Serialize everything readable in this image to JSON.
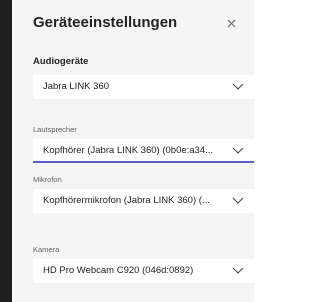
{
  "dialog": {
    "title": "Geräteeinstellungen",
    "close_icon": "close-icon"
  },
  "audio": {
    "section_label": "Audiogeräte",
    "device_value": "Jabra LINK 360",
    "speaker_label": "Lautsprecher",
    "speaker_value": "Kopfhörer (Jabra LINK 360) (0b0e:a34...",
    "mic_label": "Mikrofon",
    "mic_value": "Kopfhörermikrofon (Jabra LINK 360) (..."
  },
  "camera": {
    "label": "Kamera",
    "value": "HD Pro Webcam C920 (046d:0892)"
  },
  "colors": {
    "accent": "#5b5fc7",
    "panel_bg": "#f5f5f5",
    "rail": "#201f1f"
  }
}
